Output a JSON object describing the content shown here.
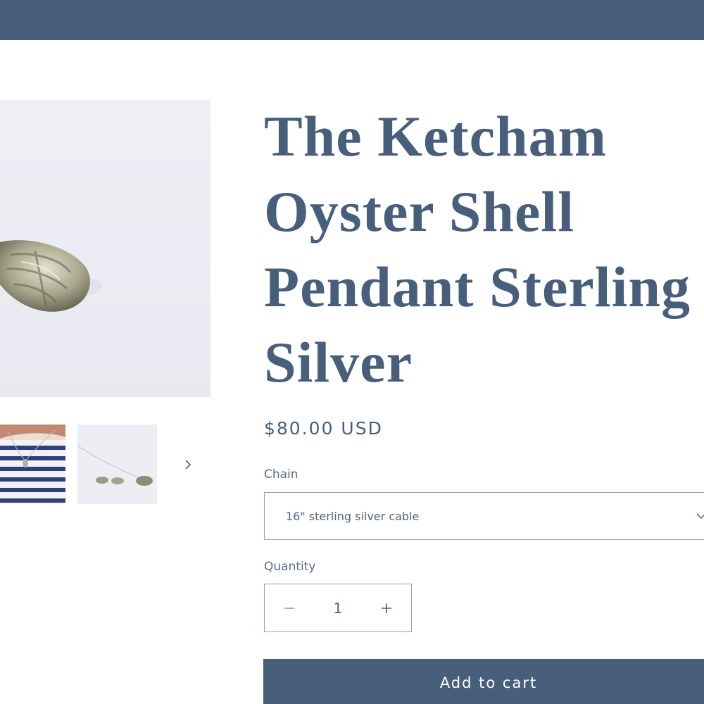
{
  "product": {
    "title": "The Ketcham\nOyster Shell\nPendant Sterling\nSilver",
    "price": "$80.00 USD"
  },
  "chain": {
    "label": "Chain",
    "selected": "16\" sterling silver cable"
  },
  "quantity": {
    "label": "Quantity",
    "value": "1"
  },
  "cart": {
    "label": "Add to cart"
  },
  "icons": {
    "thumb_next": "chevron-right-icon",
    "select": "chevron-down-icon",
    "decrease": "minus-icon",
    "increase": "plus-icon"
  },
  "colors": {
    "brand": "#475f7b",
    "border": "#8fa0b3"
  }
}
